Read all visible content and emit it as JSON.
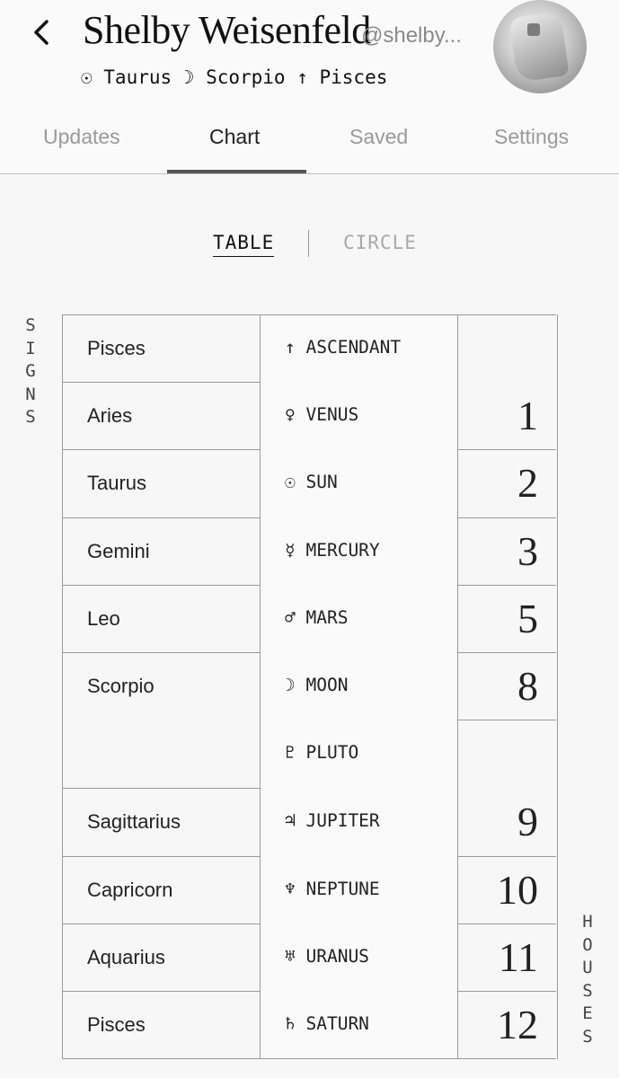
{
  "header": {
    "name": "Shelby Weisenfeld",
    "handle": "@shelby...",
    "signs_line": "☉ Taurus ☽ Scorpio ↑ Pisces"
  },
  "tabs": [
    "Updates",
    "Chart",
    "Saved",
    "Settings"
  ],
  "active_tab": "Chart",
  "view_toggle": {
    "table": "TABLE",
    "circle": "CIRCLE",
    "selected": "TABLE"
  },
  "side_labels": {
    "signs": [
      "S",
      "I",
      "G",
      "N",
      "S"
    ],
    "houses": [
      "H",
      "O",
      "U",
      "S",
      "E",
      "S"
    ]
  },
  "chart_table": {
    "signs": [
      "Pisces",
      "Aries",
      "Taurus",
      "Gemini",
      "Leo",
      "Scorpio",
      "Sagittarius",
      "Capricorn",
      "Aquarius",
      "Pisces"
    ],
    "planets": [
      "↑ ASCENDANT",
      "♀ VENUS",
      "☉ SUN",
      "☿ MERCURY",
      "♂ MARS",
      "☽ MOON",
      "♇ PLUTO",
      "♃ JUPITER",
      "♆ NEPTUNE",
      "♅ URANUS",
      "♄ SATURN"
    ],
    "houses": [
      "1",
      "2",
      "3",
      "5",
      "8",
      "9",
      "10",
      "11",
      "12"
    ]
  },
  "colors": {
    "background": "#f7f7f7",
    "text": "#111111",
    "muted": "#9a9a9a",
    "rule": "#9a9a9a"
  }
}
